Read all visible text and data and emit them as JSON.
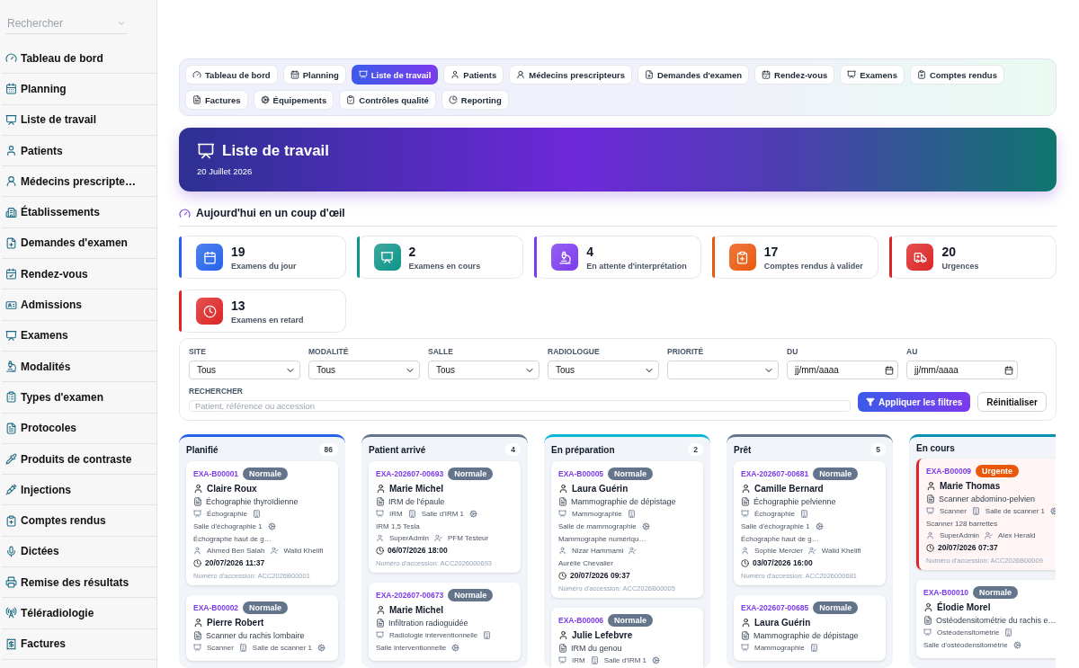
{
  "sidebar": {
    "search": {
      "placeholder": "Rechercher"
    },
    "items": [
      {
        "label": "Tableau de bord"
      },
      {
        "label": "Planning"
      },
      {
        "label": "Liste de travail"
      },
      {
        "label": "Patients"
      },
      {
        "label": "Médecins prescripte…"
      },
      {
        "label": "Établissements"
      },
      {
        "label": "Demandes d'examen"
      },
      {
        "label": "Rendez-vous"
      },
      {
        "label": "Admissions"
      },
      {
        "label": "Examens"
      },
      {
        "label": "Modalités"
      },
      {
        "label": "Types d'examen"
      },
      {
        "label": "Protocoles"
      },
      {
        "label": "Produits de contraste"
      },
      {
        "label": "Injections"
      },
      {
        "label": "Comptes rendus"
      },
      {
        "label": "Dictées"
      },
      {
        "label": "Remise des résultats"
      },
      {
        "label": "Téléradiologie"
      },
      {
        "label": "Factures"
      }
    ]
  },
  "tabs": [
    {
      "label": "Tableau de bord",
      "selected": false
    },
    {
      "label": "Planning",
      "selected": false
    },
    {
      "label": "Liste de travail",
      "selected": true
    },
    {
      "label": "Patients",
      "selected": false
    },
    {
      "label": "Médecins prescripteurs",
      "selected": false
    },
    {
      "label": "Demandes d'examen",
      "selected": false
    },
    {
      "label": "Rendez-vous",
      "selected": false
    },
    {
      "label": "Examens",
      "selected": false
    },
    {
      "label": "Comptes rendus",
      "selected": false
    },
    {
      "label": "Factures",
      "selected": false
    },
    {
      "label": "Équipements",
      "selected": false
    },
    {
      "label": "Contrôles qualité",
      "selected": false
    },
    {
      "label": "Reporting",
      "selected": false
    }
  ],
  "header": {
    "title": "Liste de travail",
    "date": "20 Juillet 2026"
  },
  "overview": {
    "title": "Aujourd'hui en un coup d'œil",
    "stats": [
      {
        "value": "19",
        "label": "Examens du jour",
        "color": "#2563eb"
      },
      {
        "value": "2",
        "label": "Examens en cours",
        "color": "#0d9488"
      },
      {
        "value": "4",
        "label": "En attente d'interprétation",
        "color": "#7c3aed"
      },
      {
        "value": "17",
        "label": "Comptes rendus à valider",
        "color": "#ea580c"
      },
      {
        "value": "20",
        "label": "Urgences",
        "color": "#dc2626"
      },
      {
        "value": "13",
        "label": "Examens en retard",
        "color": "#dc2626"
      }
    ]
  },
  "filters": {
    "fields": [
      {
        "label": "SITE",
        "kind": "select",
        "value": "Tous"
      },
      {
        "label": "MODALITÉ",
        "kind": "select",
        "value": "Tous"
      },
      {
        "label": "SALLE",
        "kind": "select",
        "value": "Tous"
      },
      {
        "label": "RADIOLOGUE",
        "kind": "select",
        "value": "Tous"
      },
      {
        "label": "PRIORITÉ",
        "kind": "select"
      },
      {
        "label": "DU",
        "kind": "date",
        "placeholder": "jj/mm/aaaa"
      },
      {
        "label": "AU",
        "kind": "date",
        "placeholder": "jj/mm/aaaa"
      }
    ],
    "search": {
      "label": "RECHERCHER",
      "placeholder": "Patient, référence ou accession"
    },
    "buttons": [
      {
        "label": "Appliquer les filtres",
        "kind": "primary"
      },
      {
        "label": "Réinitialiser",
        "kind": "secondary"
      }
    ]
  },
  "board": {
    "columns": [
      {
        "title": "Planifié",
        "count": "86",
        "color": "#2563eb",
        "cards": [
          {
            "ref": "EXA-B00001",
            "priority": {
              "label": "Normale",
              "kind": "normal"
            },
            "patient": "Claire Roux",
            "exam": "Échographie thyroïdienne",
            "modality": "Échographie",
            "room": "Salle d'échographie 1",
            "equipment": "Échographe haut de g…",
            "requester": "Ahmed Ben Salah",
            "radiologist": "Walid Khelifi",
            "datetime": "20/07/2026 11:37",
            "accession": "Numéro d'accession: ACC2026B00001"
          },
          {
            "ref": "EXA-B00002",
            "priority": {
              "label": "Normale",
              "kind": "normal"
            },
            "patient": "Pierre Robert",
            "exam": "Scanner du rachis lombaire",
            "modality": "Scanner",
            "room": "Salle de scanner 1"
          }
        ]
      },
      {
        "title": "Patient arrivé",
        "count": "4",
        "color": "#64748b",
        "cards": [
          {
            "ref": "EXA-202607-00693",
            "priority": {
              "label": "Normale",
              "kind": "normal"
            },
            "patient": "Marie Michel",
            "exam": "IRM de l'épaule",
            "modality": "IRM",
            "room": "Salle d'IRM 1",
            "equipment": "IRM 1,5 Tesla",
            "requester": "SuperAdmin",
            "radiologist": "PFM Testeur",
            "datetime": "06/07/2026 18:00",
            "accession": "Numéro d'accession: ACC2026000693"
          },
          {
            "ref": "EXA-202607-00673",
            "priority": {
              "label": "Normale",
              "kind": "normal"
            },
            "patient": "Marie Michel",
            "exam": "Infiltration radioguidée",
            "modality": "Radiologie interventionnelle",
            "room": "Salle interventionnelle"
          }
        ]
      },
      {
        "title": "En préparation",
        "count": "2",
        "color": "#06b6d4",
        "cards": [
          {
            "ref": "EXA-B00005",
            "priority": {
              "label": "Normale",
              "kind": "normal"
            },
            "patient": "Laura Guérin",
            "exam": "Mammographie de dépistage",
            "modality": "Mammographie",
            "room": "Salle de mammographie",
            "equipment": "Mammographe numériqu…",
            "requester": "Nizar Hammami",
            "radiologist": "Aurélie Chevalier",
            "datetime": "20/07/2026 09:37",
            "accession": "Numéro d'accession: ACC2026B00005"
          },
          {
            "ref": "EXA-B00006",
            "priority": {
              "label": "Normale",
              "kind": "normal"
            },
            "patient": "Julie Lefebvre",
            "exam": "IRM du genou",
            "modality": "IRM",
            "room": "Salle d'IRM 1"
          }
        ]
      },
      {
        "title": "Prêt",
        "count": "5",
        "color": "#64748b",
        "cards": [
          {
            "ref": "EXA-202607-00681",
            "priority": {
              "label": "Normale",
              "kind": "normal"
            },
            "patient": "Camille Bernard",
            "exam": "Échographie pelvienne",
            "modality": "Échographie",
            "room": "Salle d'échographie 1",
            "equipment": "Échographe haut de g…",
            "requester": "Sophie Mercier",
            "radiologist": "Walid Khelifi",
            "datetime": "03/07/2026 16:00",
            "accession": "Numéro d'accession: ACC2026000681"
          },
          {
            "ref": "EXA-202607-00685",
            "priority": {
              "label": "Normale",
              "kind": "normal"
            },
            "patient": "Laura Guérin",
            "exam": "Mammographie de dépistage",
            "modality": "Mammographie"
          }
        ]
      },
      {
        "title": "En cours",
        "color": "#0891b2",
        "cards": [
          {
            "ref": "EXA-B00009",
            "priority": {
              "label": "Urgente",
              "kind": "urgent"
            },
            "patient": "Marie Thomas",
            "exam": "Scanner abdomino-pelvien",
            "modality": "Scanner",
            "room": "Salle de scanner 1",
            "equipment": "Scanner 128 barrettes",
            "requester": "SuperAdmin",
            "radiologist": "Alex Herald",
            "datetime": "20/07/2026 07:37",
            "accession": "Numéro d'accession: ACC2026B00009"
          },
          {
            "ref": "EXA-B00010",
            "priority": {
              "label": "Normale",
              "kind": "normal"
            },
            "patient": "Élodie Morel",
            "exam": "Ostéodensitométrie du rachis e…",
            "modality": "Ostéodensitométrie",
            "room": "Salle d'ostéodensitométrie"
          }
        ]
      }
    ]
  }
}
